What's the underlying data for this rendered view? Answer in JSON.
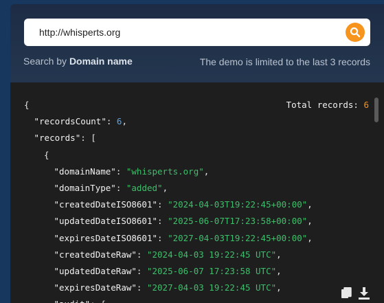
{
  "search": {
    "value": "http://whisperts.org",
    "button_icon": "search-icon",
    "button_color": "#f7941d"
  },
  "hints": {
    "left_prefix": "Search by",
    "left_bold": "Domain name",
    "right": "The demo is limited to the last 3 records"
  },
  "result": {
    "total_label": "Total records:",
    "total_value": "6",
    "lines": [
      {
        "indent": 0,
        "parts": [
          {
            "t": "{",
            "c": "p"
          }
        ]
      },
      {
        "indent": 1,
        "parts": [
          {
            "t": "\"recordsCount\"",
            "c": "k"
          },
          {
            "t": ": ",
            "c": "p"
          },
          {
            "t": "6",
            "c": "n"
          },
          {
            "t": ",",
            "c": "p"
          }
        ]
      },
      {
        "indent": 1,
        "parts": [
          {
            "t": "\"records\"",
            "c": "k"
          },
          {
            "t": ": [",
            "c": "p"
          }
        ]
      },
      {
        "indent": 2,
        "parts": [
          {
            "t": "{",
            "c": "p"
          }
        ]
      },
      {
        "indent": 3,
        "parts": [
          {
            "t": "\"domainName\"",
            "c": "k"
          },
          {
            "t": ": ",
            "c": "p"
          },
          {
            "t": "\"whisperts.org\"",
            "c": "s"
          },
          {
            "t": ",",
            "c": "p"
          }
        ]
      },
      {
        "indent": 3,
        "parts": [
          {
            "t": "\"domainType\"",
            "c": "k"
          },
          {
            "t": ": ",
            "c": "p"
          },
          {
            "t": "\"added\"",
            "c": "s"
          },
          {
            "t": ",",
            "c": "p"
          }
        ]
      },
      {
        "indent": 3,
        "parts": [
          {
            "t": "\"createdDateISO8601\"",
            "c": "k"
          },
          {
            "t": ": ",
            "c": "p"
          },
          {
            "t": "\"2024-04-03T19:22:45+00:00\"",
            "c": "s"
          },
          {
            "t": ",",
            "c": "p"
          }
        ]
      },
      {
        "indent": 3,
        "parts": [
          {
            "t": "\"updatedDateISO8601\"",
            "c": "k"
          },
          {
            "t": ": ",
            "c": "p"
          },
          {
            "t": "\"2025-06-07T17:23:58+00:00\"",
            "c": "s"
          },
          {
            "t": ",",
            "c": "p"
          }
        ]
      },
      {
        "indent": 3,
        "parts": [
          {
            "t": "\"expiresDateISO8601\"",
            "c": "k"
          },
          {
            "t": ": ",
            "c": "p"
          },
          {
            "t": "\"2027-04-03T19:22:45+00:00\"",
            "c": "s"
          },
          {
            "t": ",",
            "c": "p"
          }
        ]
      },
      {
        "indent": 3,
        "parts": [
          {
            "t": "\"createdDateRaw\"",
            "c": "k"
          },
          {
            "t": ": ",
            "c": "p"
          },
          {
            "t": "\"2024-04-03 19:22:45 UTC\"",
            "c": "s"
          },
          {
            "t": ",",
            "c": "p"
          }
        ]
      },
      {
        "indent": 3,
        "parts": [
          {
            "t": "\"updatedDateRaw\"",
            "c": "k"
          },
          {
            "t": ": ",
            "c": "p"
          },
          {
            "t": "\"2025-06-07 17:23:58 UTC\"",
            "c": "s"
          },
          {
            "t": ",",
            "c": "p"
          }
        ]
      },
      {
        "indent": 3,
        "parts": [
          {
            "t": "\"expiresDateRaw\"",
            "c": "k"
          },
          {
            "t": ": ",
            "c": "p"
          },
          {
            "t": "\"2027-04-03 19:22:45 UTC\"",
            "c": "s"
          },
          {
            "t": ",",
            "c": "p"
          }
        ]
      },
      {
        "indent": 3,
        "parts": [
          {
            "t": "\"audit\"",
            "c": "k"
          },
          {
            "t": ": {",
            "c": "p"
          }
        ]
      }
    ]
  },
  "actions": {
    "copy_icon": "copy-icon",
    "download_icon": "download-icon"
  }
}
